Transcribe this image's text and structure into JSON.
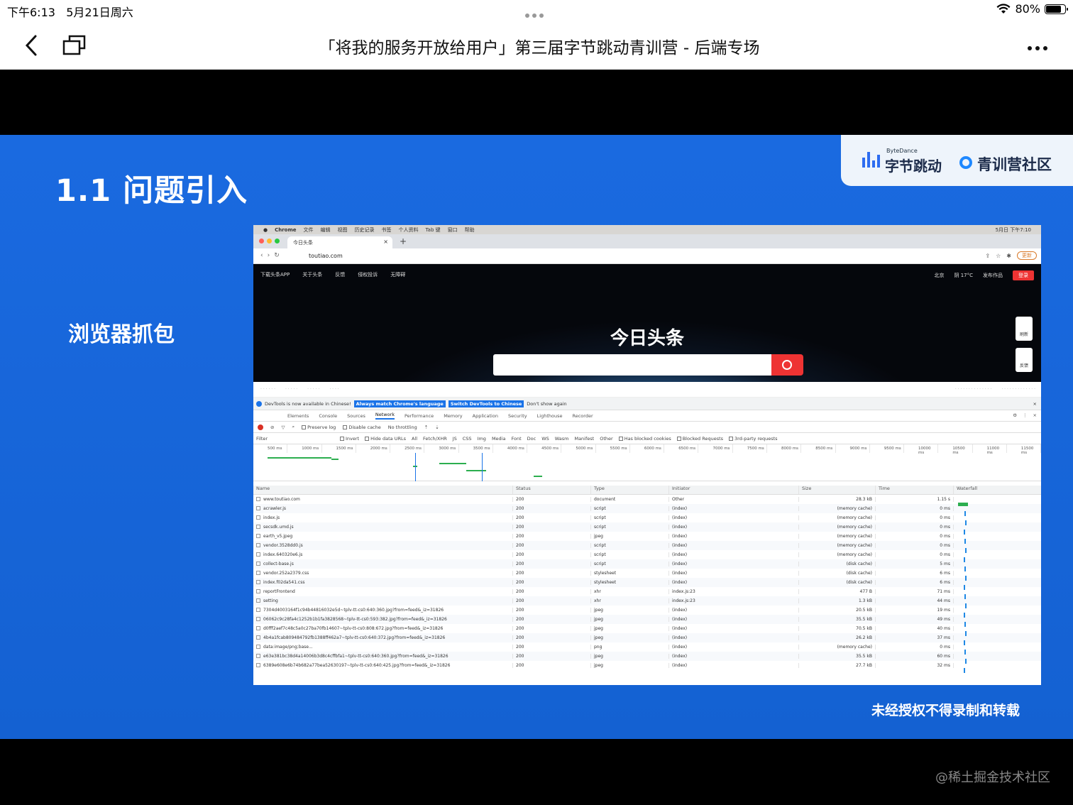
{
  "status_bar": {
    "time": "下午6:13",
    "date": "5月21日周六",
    "battery": "80%",
    "battery_level": 0.8
  },
  "nav": {
    "title": "「将我的服务开放给用户」第三届字节跳动青训营 - 后端专场"
  },
  "slide": {
    "title": "1.1 问题引入",
    "subtitle": "浏览器抓包",
    "footer": "未经授权不得录制和转载",
    "logo_small": "ByteDance",
    "logo_bytedance": "字节跳动",
    "logo_community": "青训营社区"
  },
  "browser": {
    "mac_menu": [
      "Chrome",
      "文件",
      "编辑",
      "视图",
      "历史记录",
      "书签",
      "个人资料",
      "Tab 键",
      "窗口",
      "帮助"
    ],
    "mac_right": [
      "5月日 下午7:10"
    ],
    "tab_title": "今日头条",
    "url": "toutiao.com",
    "update_label": "更新",
    "page_nav": [
      "下载头条APP",
      "关于头条",
      "反馈",
      "侵权投诉",
      "无障碍"
    ],
    "page_nav_right": [
      "北京",
      "阴 17°C",
      "发布作品"
    ],
    "login_label": "登录",
    "logo_text": "今日头条",
    "side_refresh": "刷新",
    "side_feedback": "反馈"
  },
  "devtools": {
    "info_text": "DevTools is now available in Chinese!",
    "btn_always": "Always match Chrome's language",
    "btn_switch": "Switch DevTools to Chinese",
    "dont_show": "Don't show again",
    "tabs": [
      "Elements",
      "Console",
      "Sources",
      "Network",
      "Performance",
      "Memory",
      "Application",
      "Security",
      "Lighthouse",
      "Recorder"
    ],
    "active_tab": "Network",
    "toolbar": [
      "Preserve log",
      "Disable cache",
      "No throttling"
    ],
    "filter_items": [
      "Filter",
      "Invert",
      "Hide data URLs",
      "All",
      "Fetch/XHR",
      "JS",
      "CSS",
      "Img",
      "Media",
      "Font",
      "Doc",
      "WS",
      "Wasm",
      "Manifest",
      "Other",
      "Has blocked cookies",
      "Blocked Requests",
      "3rd-party requests"
    ],
    "ticks": [
      "500 ms",
      "1000 ms",
      "1500 ms",
      "2000 ms",
      "2500 ms",
      "3000 ms",
      "3500 ms",
      "4000 ms",
      "4500 ms",
      "5000 ms",
      "5500 ms",
      "6000 ms",
      "6500 ms",
      "7000 ms",
      "7500 ms",
      "8000 ms",
      "8500 ms",
      "9000 ms",
      "9500 ms",
      "10000 ms",
      "10500 ms",
      "11000 ms",
      "11500 ms"
    ],
    "columns": [
      "Name",
      "Status",
      "Type",
      "Initiator",
      "Size",
      "Time",
      "Waterfall"
    ],
    "rows": [
      [
        "www.toutiao.com",
        "200",
        "document",
        "Other",
        "28.3 kB",
        "1.15 s"
      ],
      [
        "acrawler.js",
        "200",
        "script",
        "(index)",
        "(memory cache)",
        "0 ms"
      ],
      [
        "index.js",
        "200",
        "script",
        "(index)",
        "(memory cache)",
        "0 ms"
      ],
      [
        "secsdk.umd.js",
        "200",
        "script",
        "(index)",
        "(memory cache)",
        "0 ms"
      ],
      [
        "earth_v5.jpeg",
        "200",
        "jpeg",
        "(index)",
        "(memory cache)",
        "0 ms"
      ],
      [
        "vendor.3528dd0.js",
        "200",
        "script",
        "(index)",
        "(memory cache)",
        "0 ms"
      ],
      [
        "index.640320e6.js",
        "200",
        "script",
        "(index)",
        "(memory cache)",
        "0 ms"
      ],
      [
        "collect-base.js",
        "200",
        "script",
        "(index)",
        "(disk cache)",
        "5 ms"
      ],
      [
        "vendor.252a2379.css",
        "200",
        "stylesheet",
        "(index)",
        "(disk cache)",
        "6 ms"
      ],
      [
        "index.f02da541.css",
        "200",
        "stylesheet",
        "(index)",
        "(disk cache)",
        "6 ms"
      ],
      [
        "reportFrontend",
        "200",
        "xhr",
        "index.js:23",
        "477 B",
        "71 ms"
      ],
      [
        "setting",
        "200",
        "xhr",
        "index.js:23",
        "1.3 kB",
        "44 ms"
      ],
      [
        "7304d4003164f1c94b44816032e5d~tplv-tt-cs0:640:360.jpg?from=feed&_iz=31826",
        "200",
        "jpeg",
        "(index)",
        "20.5 kB",
        "19 ms"
      ],
      [
        "06062c9c28fa4c1252b1b1fa3828568~tplv-tt-cs0:593:382.jpg?from=feed&_iz=31826",
        "200",
        "jpeg",
        "(index)",
        "35.5 kB",
        "49 ms"
      ],
      [
        "d0fff2aef7c48c5a0c27ba70fb14607~tplv-tt-cs0:808:672.jpg?from=feed&_iz=31826",
        "200",
        "jpeg",
        "(index)",
        "70.5 kB",
        "40 ms"
      ],
      [
        "4b4a1fcab809484792fb1388ff462a7~tplv-tt-cs0:640:372.jpg?from=feed&_iz=31826",
        "200",
        "jpeg",
        "(index)",
        "26.2 kB",
        "37 ms"
      ],
      [
        "data:image/png;base...",
        "200",
        "png",
        "(index)",
        "(memory cache)",
        "0 ms"
      ],
      [
        "e63e381bc38d4a14006b3d8c4cffbfa1~tplv-tt-cs0:640:360.jpg?from=feed&_iz=31826",
        "200",
        "jpeg",
        "(index)",
        "35.5 kB",
        "60 ms"
      ],
      [
        "6389e608e6b74b682a77bea52630197~tplv-tt-cs0:640:425.jpg?from=feed&_iz=31826",
        "200",
        "jpeg",
        "(index)",
        "27.7 kB",
        "32 ms"
      ]
    ]
  },
  "watermark": "@稀土掘金技术社区"
}
